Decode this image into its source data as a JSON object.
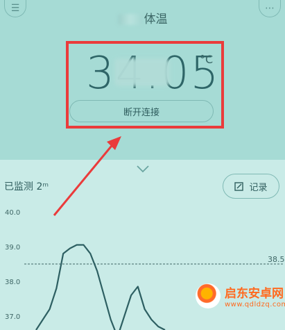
{
  "header": {
    "title_visible": "体温",
    "menu_icon": "list-icon",
    "more_icon": "more-icon"
  },
  "reading": {
    "temperature_visible": "34.05",
    "unit": "°C"
  },
  "actions": {
    "disconnect_label": "断开连接",
    "record_label": "记录"
  },
  "monitor": {
    "label": "已监测 2ᵐ"
  },
  "chart_data": {
    "type": "line",
    "ytick_labels": [
      "40.0",
      "39.0",
      "38.0",
      "37.0"
    ],
    "ylim": [
      36.6,
      40.0
    ],
    "threshold": {
      "value": 38.5,
      "label": "38.5"
    },
    "x": [
      0,
      1,
      2,
      3,
      4,
      5,
      6,
      7,
      8,
      9,
      10,
      11,
      12,
      13,
      14,
      15,
      16,
      17,
      18,
      19
    ],
    "values": [
      36.6,
      36.9,
      37.2,
      37.8,
      38.8,
      38.95,
      39.05,
      39.05,
      38.8,
      38.3,
      37.6,
      36.9,
      36.4,
      37.0,
      37.6,
      37.85,
      37.2,
      36.9,
      36.7,
      36.6
    ]
  },
  "colors": {
    "accent_red": "#ea3b3b",
    "line": "#2d5f62",
    "watermark": "#ff6a1f"
  },
  "watermark": {
    "name": "启东安卓网",
    "url": "www.qdldzq.com"
  }
}
